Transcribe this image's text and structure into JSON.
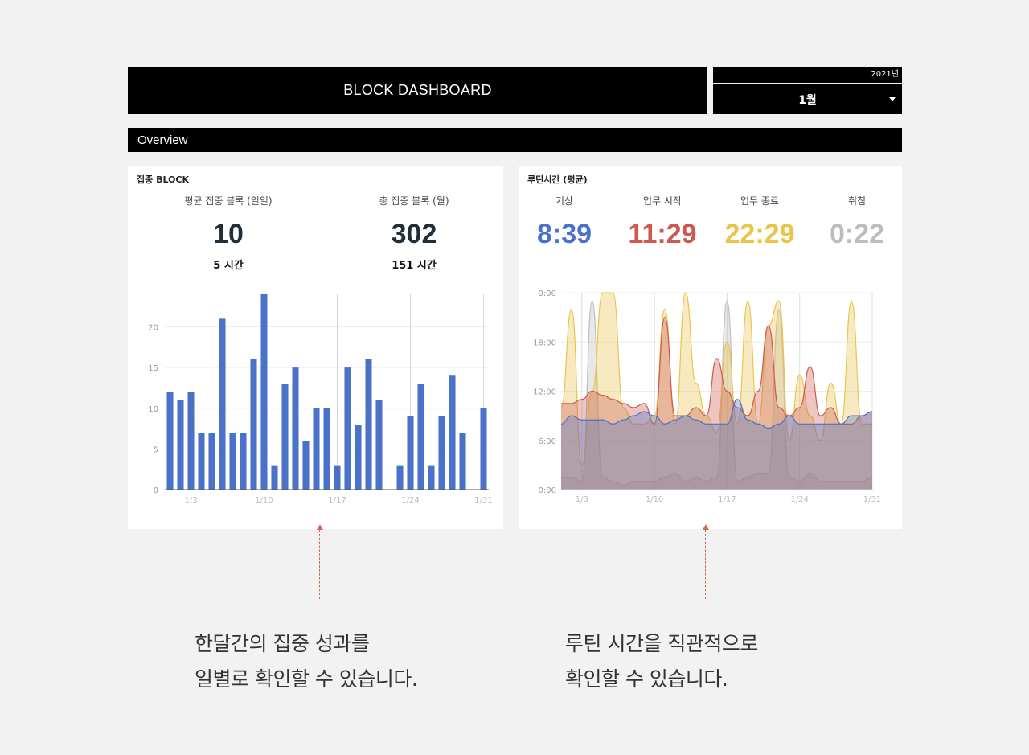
{
  "header": {
    "title": "BLOCK DASHBOARD",
    "year": "2021년",
    "month": "1월"
  },
  "overview": {
    "label": "Overview"
  },
  "focus_card": {
    "title": "집중 BLOCK",
    "kpis": [
      {
        "label": "평균 집중 블록 (일일)",
        "value": "10",
        "sub": "5 시간"
      },
      {
        "label": "총 집중 블록 (월)",
        "value": "302",
        "sub": "151 시간"
      }
    ]
  },
  "routine_card": {
    "title": "루틴시간 (평균)",
    "items": [
      {
        "label": "기상",
        "value": "8:39",
        "color": "#4a72c8"
      },
      {
        "label": "업무 시작",
        "value": "11:29",
        "color": "#cc5a52"
      },
      {
        "label": "업무 종료",
        "value": "22:29",
        "color": "#ebc44a"
      },
      {
        "label": "취침",
        "value": "0:22",
        "color": "#bdbdbd"
      }
    ]
  },
  "captions": {
    "left": [
      "한달간의 집중 성과를",
      "일별로 확인할 수 있습니다."
    ],
    "right": [
      "루틴 시간을 직관적으로",
      "확인할 수 있습니다."
    ]
  },
  "chart_data": [
    {
      "type": "bar",
      "title": "",
      "xlabel": "",
      "ylabel": "",
      "categories": [
        "1/1",
        "1/2",
        "1/3",
        "1/4",
        "1/5",
        "1/6",
        "1/7",
        "1/8",
        "1/9",
        "1/10",
        "1/11",
        "1/12",
        "1/13",
        "1/14",
        "1/15",
        "1/16",
        "1/17",
        "1/18",
        "1/19",
        "1/20",
        "1/21",
        "1/22",
        "1/23",
        "1/24",
        "1/25",
        "1/26",
        "1/27",
        "1/28",
        "1/29",
        "1/30",
        "1/31"
      ],
      "values": [
        12,
        11,
        12,
        7,
        7,
        21,
        7,
        7,
        16,
        24,
        3,
        13,
        15,
        6,
        10,
        10,
        3,
        15,
        8,
        16,
        11,
        0,
        3,
        9,
        13,
        3,
        9,
        14,
        7,
        0,
        10
      ],
      "x_tick_labels": [
        "1/3",
        "1/10",
        "1/17",
        "1/24",
        "1/31"
      ],
      "y_ticks": [
        0,
        5,
        10,
        15,
        20
      ],
      "ylim": [
        0,
        24
      ],
      "color": "#4a72c8",
      "grid": true
    },
    {
      "type": "area",
      "title": "",
      "xlabel": "",
      "ylabel": "",
      "x_tick_labels": [
        "1/3",
        "1/10",
        "1/17",
        "1/24",
        "1/31"
      ],
      "y_tick_labels": [
        "0:00",
        "6:00",
        "12:00",
        "18:00",
        "0:00"
      ],
      "ylim_hours": [
        0,
        24
      ],
      "grid": true,
      "series": [
        {
          "color": "#bdbdbd",
          "values": [
            1.5,
            1.5,
            1,
            23,
            1.5,
            1,
            0.5,
            1,
            1,
            1,
            1.5,
            2,
            1,
            1.5,
            1,
            1.5,
            23,
            1,
            1.5,
            2,
            2,
            22,
            1.5,
            1,
            2,
            1,
            1,
            1,
            1,
            1,
            1.5
          ]
        },
        {
          "color": "#ebc44a",
          "values": [
            10,
            22,
            3,
            12,
            24,
            24,
            10,
            8,
            8,
            9,
            22,
            8,
            24,
            13,
            9,
            7,
            18,
            8,
            23,
            8,
            20,
            23,
            6,
            14,
            9,
            6,
            13,
            8,
            23,
            8,
            8
          ]
        },
        {
          "color": "#cc5a52",
          "values": [
            10.5,
            10.5,
            11,
            12,
            11.5,
            11,
            10.5,
            10,
            10.5,
            8,
            21,
            9,
            9,
            10,
            9,
            16,
            12,
            10,
            9,
            12,
            20,
            10,
            9,
            10,
            15,
            9,
            10,
            8,
            8,
            9,
            9.5
          ]
        },
        {
          "color": "#4a72c8",
          "values": [
            8,
            9,
            8.5,
            8.5,
            8.5,
            8,
            8.5,
            9,
            9.5,
            9,
            8,
            8.5,
            9,
            8.5,
            8,
            8,
            8,
            11,
            8.5,
            8,
            7.5,
            8,
            9,
            8,
            8,
            8,
            8,
            8,
            9,
            9,
            9.5
          ]
        }
      ]
    }
  ]
}
